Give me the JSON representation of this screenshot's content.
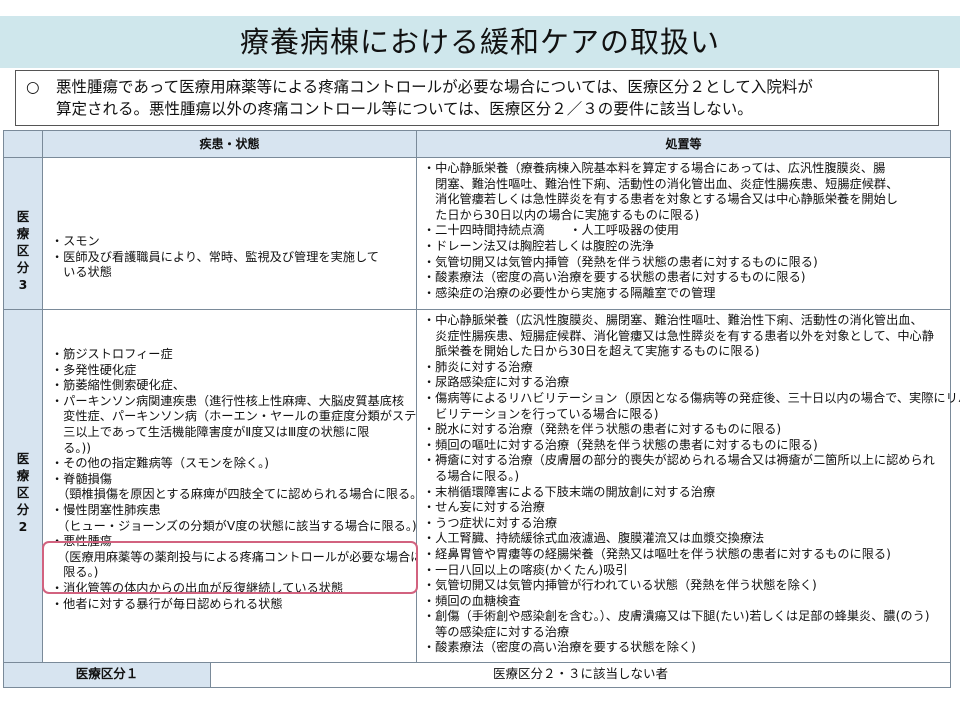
{
  "title": "療養病棟における緩和ケアの取扱い",
  "note": {
    "bullet": "○",
    "line1": "悪性腫瘍であって医療用麻薬等による疼痛コントロールが必要な場合については、医療区分２として入院料が",
    "line2": "算定される。悪性腫瘍以外の疼痛コントロール等については、医療区分２／３の要件に該当しない。"
  },
  "table": {
    "col_headers": [
      "疾患・状態",
      "処置等"
    ],
    "rows": [
      {
        "label": [
          "医",
          "療",
          "区",
          "分",
          "3"
        ],
        "conditions": [
          "・スモン",
          "・医師及び看護職員により、常時、監視及び管理を実施して",
          "　いる状態"
        ],
        "treatments": [
          "・中心静脈栄養（療養病棟入院基本料を算定する場合にあっては、広汎性腹膜炎、腸",
          "　閉塞、難治性嘔吐、難治性下痢、活動性の消化管出血、炎症性腸疾患、短腸症候群、",
          "　消化管瘻若しくは急性膵炎を有する患者を対象とする場合又は中心静脈栄養を開始し",
          "　た日から30日以内の場合に実施するものに限る)",
          "・二十四時間持続点滴　　・人工呼吸器の使用",
          "・ドレーン法又は胸腔若しくは腹腔の洗浄",
          "・気管切開又は気管内挿管（発熱を伴う状態の患者に対するものに限る)",
          "・酸素療法（密度の高い治療を要する状態の患者に対するものに限る)",
          "・感染症の治療の必要性から実施する隔離室での管理"
        ]
      },
      {
        "label": [
          "医",
          "療",
          "区",
          "分",
          "2"
        ],
        "conditions": [
          "・筋ジストロフィー症",
          "・多発性硬化症",
          "・筋萎縮性側索硬化症、",
          "・パーキンソン病関連疾患（進行性核上性麻痺、大脳皮質基底核",
          "　変性症、パーキンソン病（ホーエン・ヤールの重症度分類がステージ",
          "　三以上であって生活機能障害度がⅡ度又はⅢ度の状態に限",
          "　る。))",
          "・その他の指定難病等（スモンを除く。)",
          "・脊髄損傷",
          "　（頸椎損傷を原因とする麻痺が四肢全てに認められる場合に限る。)",
          "・慢性閉塞性肺疾患",
          "　（ヒュー・ジョーンズの分類がⅤ度の状態に該当する場合に限る。)",
          "・悪性腫瘍",
          "　（医療用麻薬等の薬剤投与による疼痛コントロールが必要な場合に",
          "　限る。)",
          "・消化管等の体内からの出血が反復継続している状態",
          "・他者に対する暴行が毎日認められる状態"
        ],
        "treatments": [
          "・中心静脈栄養（広汎性腹膜炎、腸閉塞、難治性嘔吐、難治性下痢、活動性の消化管出血、",
          "　炎症性腸疾患、短腸症候群、消化管瘻又は急性膵炎を有する患者以外を対象として、中心静",
          "　脈栄養を開始した日から30日を超えて実施するものに限る)",
          "・肺炎に対する治療",
          "・尿路感染症に対する治療",
          "・傷病等によるリハビリテーション（原因となる傷病等の発症後、三十日以内の場合で、実際にリハ",
          "　ビリテーションを行っている場合に限る)",
          "・脱水に対する治療（発熱を伴う状態の患者に対するものに限る)",
          "・頻回の嘔吐に対する治療（発熱を伴う状態の患者に対するものに限る)",
          "・褥瘡に対する治療（皮膚層の部分的喪失が認められる場合又は褥瘡が二箇所以上に認められ",
          "　る場合に限る。)",
          "・末梢循環障害による下肢末端の開放創に対する治療",
          "・せん妄に対する治療",
          "・うつ症状に対する治療",
          "・人工腎臓、持続緩徐式血液濾過、腹膜灌流又は血漿交換療法",
          "・経鼻胃管や胃瘻等の経腸栄養（発熱又は嘔吐を伴う状態の患者に対するものに限る)",
          "・一日八回以上の喀痰(かくたん)吸引",
          "・気管切開又は気管内挿管が行われている状態（発熱を伴う状態を除く)",
          "・頻回の血糖検査",
          "・創傷（手術創や感染創を含む。）、皮膚潰瘍又は下腿(たい)若しくは足部の蜂巣炎、膿(のう)",
          "　等の感染症に対する治療",
          "・酸素療法（密度の高い治療を要する状態を除く)"
        ]
      }
    ],
    "footer": {
      "label": "医療区分１",
      "value": "医療区分２・３に該当しない者"
    }
  }
}
